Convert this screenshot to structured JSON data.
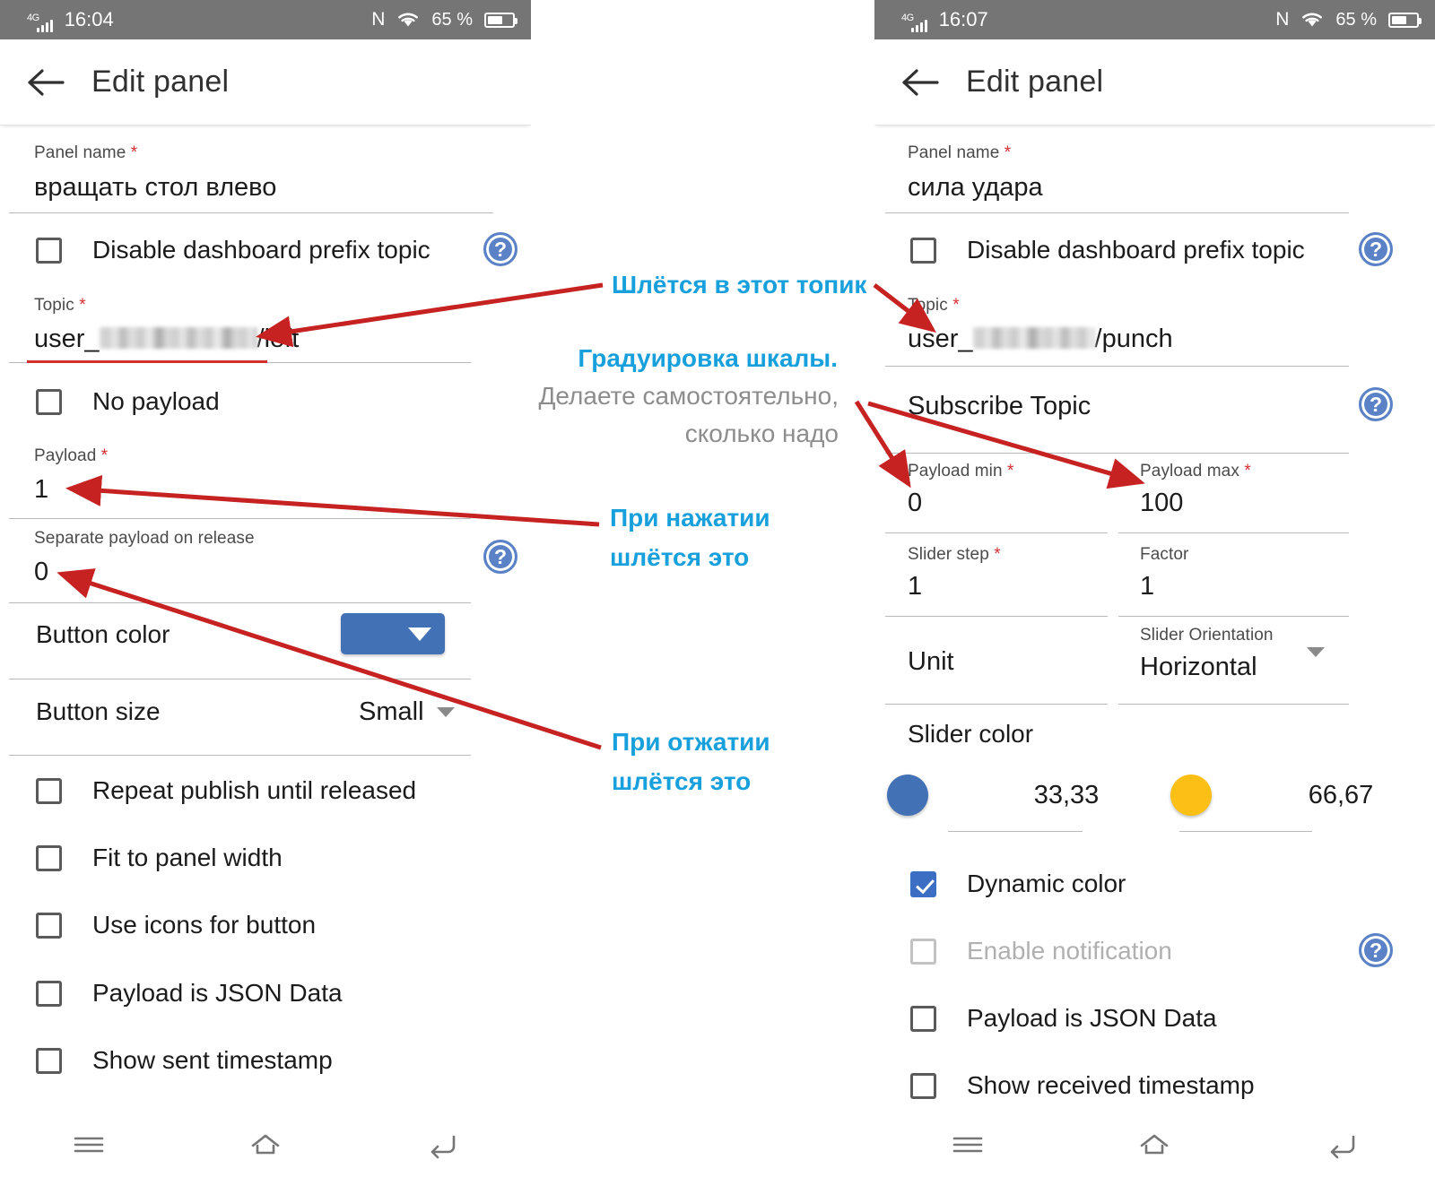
{
  "left_phone": {
    "statusbar": {
      "network": "4G",
      "time": "16:04",
      "nfc": "N",
      "wifi": "wifi-icon",
      "battery_pct": "65 %"
    },
    "appbar": {
      "back": "back-arrow-icon",
      "title": "Edit panel"
    },
    "fields": {
      "panel_name": {
        "label": "Panel name",
        "required": true,
        "value": "вращать стол влево"
      },
      "disable_prefix": {
        "label": "Disable dashboard prefix topic",
        "checked": false
      },
      "topic": {
        "label": "Topic",
        "required": true,
        "prefix": "user_",
        "suffix": "/left",
        "error": true
      },
      "no_payload": {
        "label": "No payload",
        "checked": false
      },
      "payload": {
        "label": "Payload",
        "required": true,
        "value": "1"
      },
      "separate_payload": {
        "label": "Separate payload on release",
        "required": false,
        "value": "0"
      },
      "button_color": {
        "label": "Button color",
        "color": "#4271b5"
      },
      "button_size": {
        "label": "Button size",
        "value": "Small"
      }
    },
    "checkboxes": [
      {
        "label": "Repeat publish until released",
        "checked": false
      },
      {
        "label": "Fit to panel width",
        "checked": false
      },
      {
        "label": "Use icons for button",
        "checked": false
      },
      {
        "label": "Payload is JSON Data",
        "checked": false
      },
      {
        "label": "Show sent timestamp",
        "checked": false
      }
    ],
    "navbar": {
      "recents": "menu-icon",
      "home": "home-icon",
      "back": "back-icon"
    }
  },
  "right_phone": {
    "statusbar": {
      "network": "4G",
      "time": "16:07",
      "nfc": "N",
      "wifi": "wifi-icon",
      "battery_pct": "65 %"
    },
    "appbar": {
      "back": "back-arrow-icon",
      "title": "Edit panel"
    },
    "fields": {
      "panel_name": {
        "label": "Panel name",
        "required": true,
        "value": "сила удара"
      },
      "disable_prefix": {
        "label": "Disable dashboard prefix topic",
        "checked": false
      },
      "topic": {
        "label": "Topic",
        "required": true,
        "prefix": "user_",
        "suffix": "/punch"
      },
      "subscribe_topic": {
        "label": "Subscribe Topic",
        "value": ""
      },
      "payload_min": {
        "label": "Payload min",
        "required": true,
        "value": "0"
      },
      "payload_max": {
        "label": "Payload max",
        "required": true,
        "value": "100"
      },
      "slider_step": {
        "label": "Slider step",
        "required": true,
        "value": "1"
      },
      "factor": {
        "label": "Factor",
        "required": false,
        "value": "1"
      },
      "unit": {
        "label": "Unit",
        "value": ""
      },
      "slider_orientation": {
        "label": "Slider Orientation",
        "value": "Horizontal"
      },
      "slider_color": {
        "label": "Slider color",
        "stops": [
          {
            "color": "#4271b5",
            "threshold": "33,33"
          },
          {
            "color": "#fbbf15",
            "threshold": "66,67"
          },
          {
            "color": "#e8334a",
            "threshold": ""
          }
        ]
      }
    },
    "checkboxes": [
      {
        "label": "Dynamic color",
        "checked": true,
        "disabled": false
      },
      {
        "label": "Enable notification",
        "checked": false,
        "disabled": true
      },
      {
        "label": "Payload is JSON Data",
        "checked": false,
        "disabled": false
      },
      {
        "label": "Show received timestamp",
        "checked": false,
        "disabled": false
      }
    ],
    "navbar": {
      "recents": "menu-icon",
      "home": "home-icon",
      "back": "back-icon"
    }
  },
  "annotations": {
    "a1": "Шлётся в этот топик",
    "a2_title": "Градуировка шкалы.",
    "a2_line1": "Делаете самостоятельно,",
    "a2_line2": "сколько надо",
    "a3_line1": "При нажатии",
    "a3_line2": "шлётся это",
    "a4_line1": "При отжатии",
    "a4_line2": "шлётся это",
    "accent_color": "#18a0dc",
    "muted_color": "#8d8d8d",
    "arrow_color": "#c62222"
  }
}
